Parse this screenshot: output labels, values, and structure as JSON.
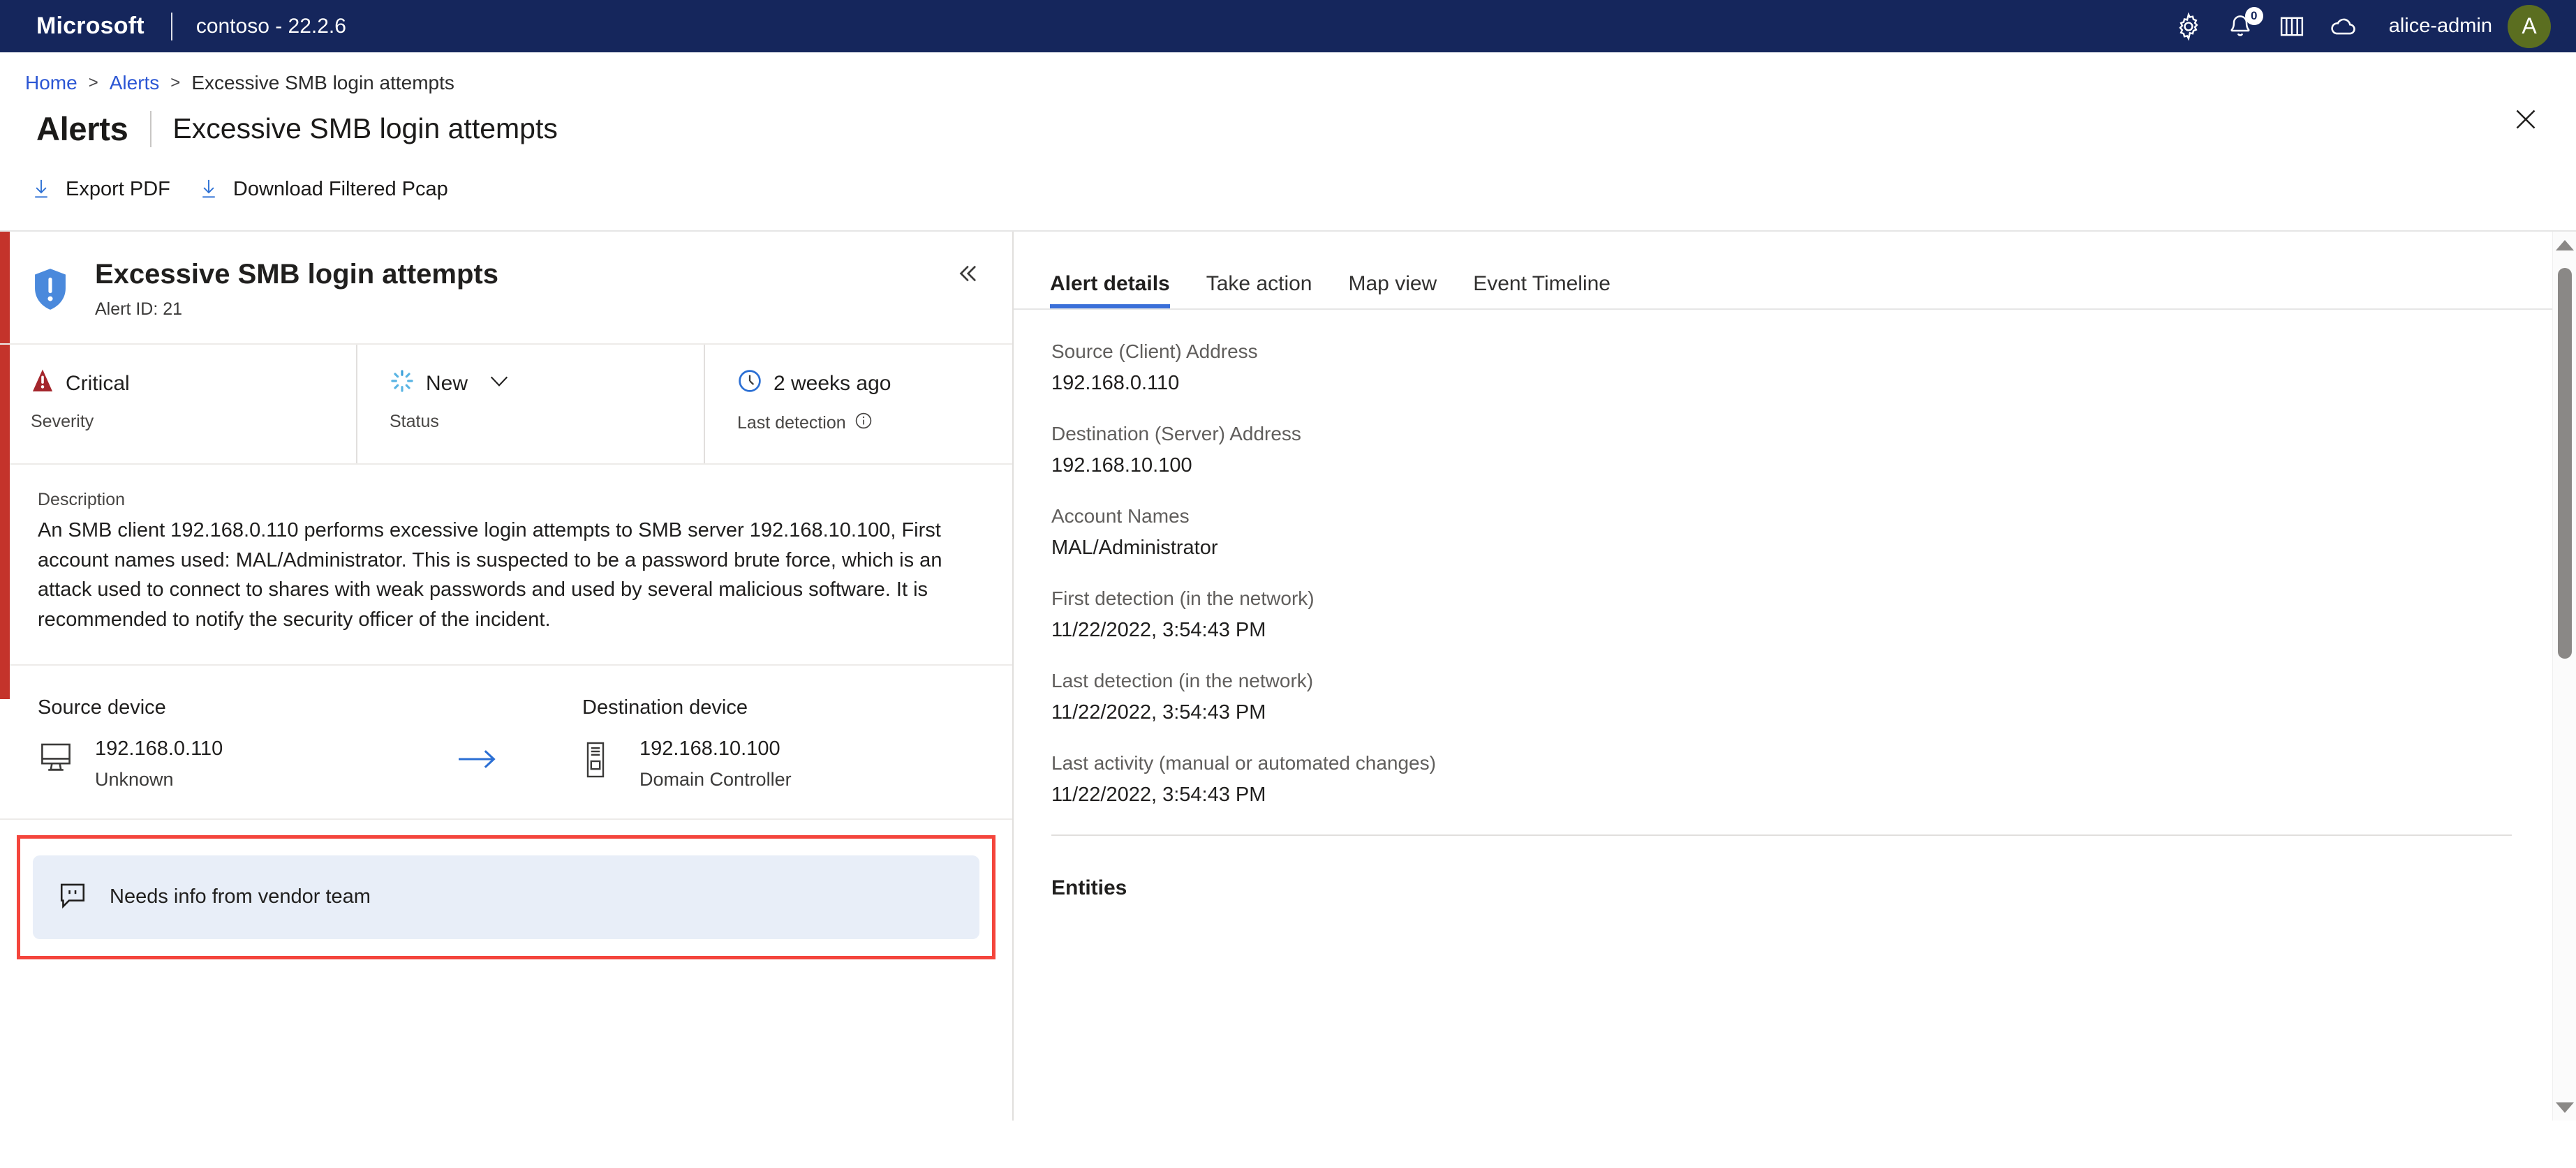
{
  "topbar": {
    "brand": "Microsoft",
    "tenant": "contoso - 22.2.6",
    "notification_count": "0",
    "user_name": "alice-admin",
    "avatar_initial": "A",
    "icons": [
      "gear-icon",
      "bell-icon",
      "book-icon",
      "cloud-icon"
    ],
    "bg_color": "#15265c",
    "avatar_color": "#5b6e20"
  },
  "breadcrumb": {
    "home": "Home",
    "alerts": "Alerts",
    "current": "Excessive SMB login attempts",
    "separator": ">"
  },
  "page_title": {
    "main": "Alerts",
    "sub": "Excessive SMB login attempts"
  },
  "commandbar": {
    "export_pdf": "Export PDF",
    "download_pcap": "Download Filtered Pcap"
  },
  "alert": {
    "title": "Excessive SMB login attempts",
    "alert_id_label": "Alert ID: 21",
    "accent_color": "#c4332b",
    "severity": {
      "value": "Critical",
      "label": "Severity",
      "color": "#a4262c"
    },
    "status": {
      "value": "New",
      "label": "Status",
      "color": "#59b4e3"
    },
    "last_detection": {
      "value": "2 weeks ago",
      "label": "Last detection",
      "color": "#2b6fd4"
    },
    "description": {
      "label": "Description",
      "text": "An SMB client 192.168.0.110 performs excessive login attempts to SMB server 192.168.10.100, First account names used: MAL/Administrator. This is suspected to be a password brute force, which is an attack used to connect to shares with weak passwords and used by several malicious software. It is recommended to notify the security officer of the incident."
    },
    "source_device": {
      "heading": "Source device",
      "ip": "192.168.0.110",
      "type": "Unknown"
    },
    "destination_device": {
      "heading": "Destination device",
      "ip": "192.168.10.100",
      "type": "Domain Controller"
    },
    "note": {
      "text": "Needs info from vendor team",
      "highlight_color": "#f4453c",
      "background": "#e8eef8"
    }
  },
  "details": {
    "tabs": [
      {
        "label": "Alert details",
        "active": true
      },
      {
        "label": "Take action",
        "active": false
      },
      {
        "label": "Map view",
        "active": false
      },
      {
        "label": "Event Timeline",
        "active": false
      }
    ],
    "fields": [
      {
        "label": "Source (Client) Address",
        "value": "192.168.0.110"
      },
      {
        "label": "Destination (Server) Address",
        "value": "192.168.10.100"
      },
      {
        "label": "Account Names",
        "value": "MAL/Administrator"
      },
      {
        "label": "First detection (in the network)",
        "value": "11/22/2022, 3:54:43 PM"
      },
      {
        "label": "Last detection (in the network)",
        "value": "11/22/2022, 3:54:43 PM"
      },
      {
        "label": "Last activity (manual or automated changes)",
        "value": "11/22/2022, 3:54:43 PM"
      }
    ],
    "entities_title": "Entities"
  }
}
